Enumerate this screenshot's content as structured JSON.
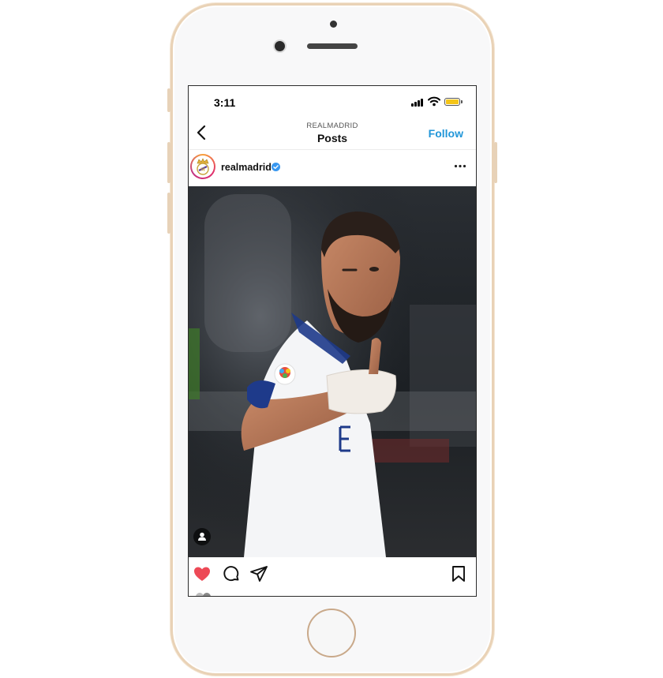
{
  "status_bar": {
    "time": "3:11",
    "battery_color": "#f5c518"
  },
  "header": {
    "account_label": "REALMADRID",
    "title": "Posts",
    "follow_label": "Follow",
    "follow_color": "#2196d8",
    "back_icon": "chevron-left-icon"
  },
  "post": {
    "username": "realmadrid",
    "verified_icon": "verified-badge-icon",
    "more_icon": "more-horizontal-icon",
    "image_icon": "user-tag-icon",
    "actions": [
      "heart-icon",
      "comment-icon",
      "share-icon",
      "bookmark-icon"
    ],
    "liked": true,
    "heart_color": "#ed4956"
  }
}
